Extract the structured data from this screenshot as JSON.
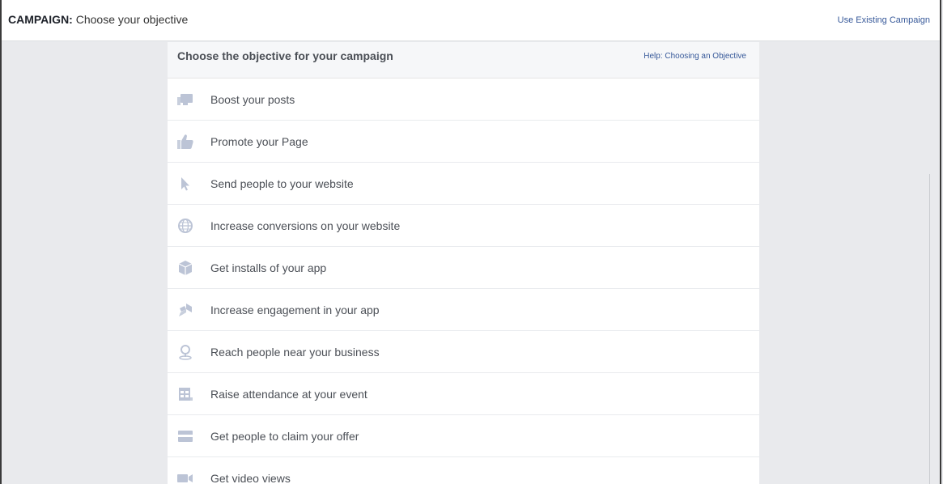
{
  "header": {
    "title_prefix": "CAMPAIGN:",
    "title_text": " Choose your objective",
    "existing_campaign_link": "Use Existing Campaign"
  },
  "panel": {
    "title": "Choose the objective for your campaign",
    "help_link": "Help: Choosing an Objective"
  },
  "objectives": [
    {
      "label": "Boost your posts",
      "icon": "posts-icon"
    },
    {
      "label": "Promote your Page",
      "icon": "thumbs-up-icon"
    },
    {
      "label": "Send people to your website",
      "icon": "cursor-icon"
    },
    {
      "label": "Increase conversions on your website",
      "icon": "globe-icon"
    },
    {
      "label": "Get installs of your app",
      "icon": "app-box-icon"
    },
    {
      "label": "Increase engagement in your app",
      "icon": "app-engagement-icon"
    },
    {
      "label": "Reach people near your business",
      "icon": "location-pin-icon"
    },
    {
      "label": "Raise attendance at your event",
      "icon": "event-calendar-icon"
    },
    {
      "label": "Get people to claim your offer",
      "icon": "offer-card-icon"
    },
    {
      "label": "Get video views",
      "icon": "video-camera-icon"
    }
  ],
  "colors": {
    "background": "#e9eaed",
    "link": "#365899",
    "icon": "#bcc4d6"
  }
}
